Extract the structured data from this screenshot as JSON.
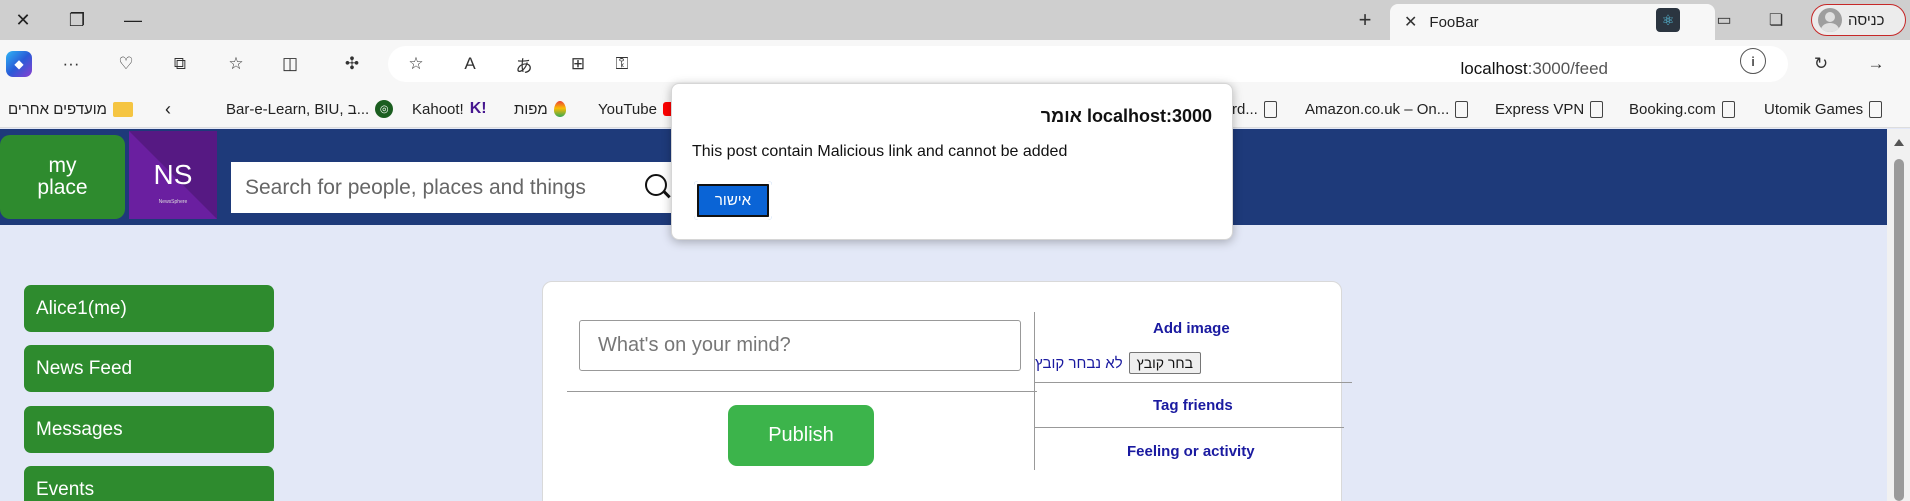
{
  "titlebar": {
    "tab_title": "FooBar",
    "profile_label": "כניסה"
  },
  "navbar": {
    "url_host": "localhost",
    "url_path": ":3000/feed"
  },
  "favorites": [
    {
      "label": "Games Utomik",
      "icon": "file"
    },
    {
      "label": "Booking.com",
      "icon": "file"
    },
    {
      "label": "Express VPN",
      "icon": "file"
    },
    {
      "label": "Amazon.co.uk – On...",
      "icon": "file"
    },
    {
      "label": "rd...",
      "icon": "file"
    },
    {
      "label": "YouTube",
      "icon": "youtube"
    },
    {
      "label": "מפות",
      "icon": "maps"
    },
    {
      "label": "Kahoot!",
      "icon": "kahoot"
    },
    {
      "label": "Bar-e-Learn, BIU, ב...",
      "icon": "biu"
    },
    {
      "label": "מועדפים אחרים",
      "icon": "folder"
    }
  ],
  "header": {
    "logo_line1": "my",
    "logo_line2": "place",
    "brand_initials": "NS",
    "brand_sub": "NewsSphere",
    "search_placeholder": "Search for people, places and things"
  },
  "sidebar": {
    "items": [
      {
        "label": "Alice1(me)"
      },
      {
        "label": "News Feed"
      },
      {
        "label": "Messages"
      },
      {
        "label": "Events"
      }
    ]
  },
  "post_card": {
    "input_placeholder": "What's on your mind?",
    "publish_label": "Publish",
    "add_image": "Add image",
    "file_button": "בחר קובץ",
    "file_status": "לא נבחר קובץ",
    "tag_friends": "Tag friends",
    "feeling": "Feeling or activity"
  },
  "dialog": {
    "title": "localhost:3000 אומר",
    "message": "This post contain Malicious link and cannot be added",
    "ok_label": "אישור"
  },
  "colors": {
    "header_bg": "#1e3a7a",
    "green_button": "#2e8b2e",
    "publish_green": "#3cb44b",
    "brand_purple": "#6a1fa0",
    "page_bg": "#e3e8f7",
    "dialog_ok": "#0a64d6"
  }
}
